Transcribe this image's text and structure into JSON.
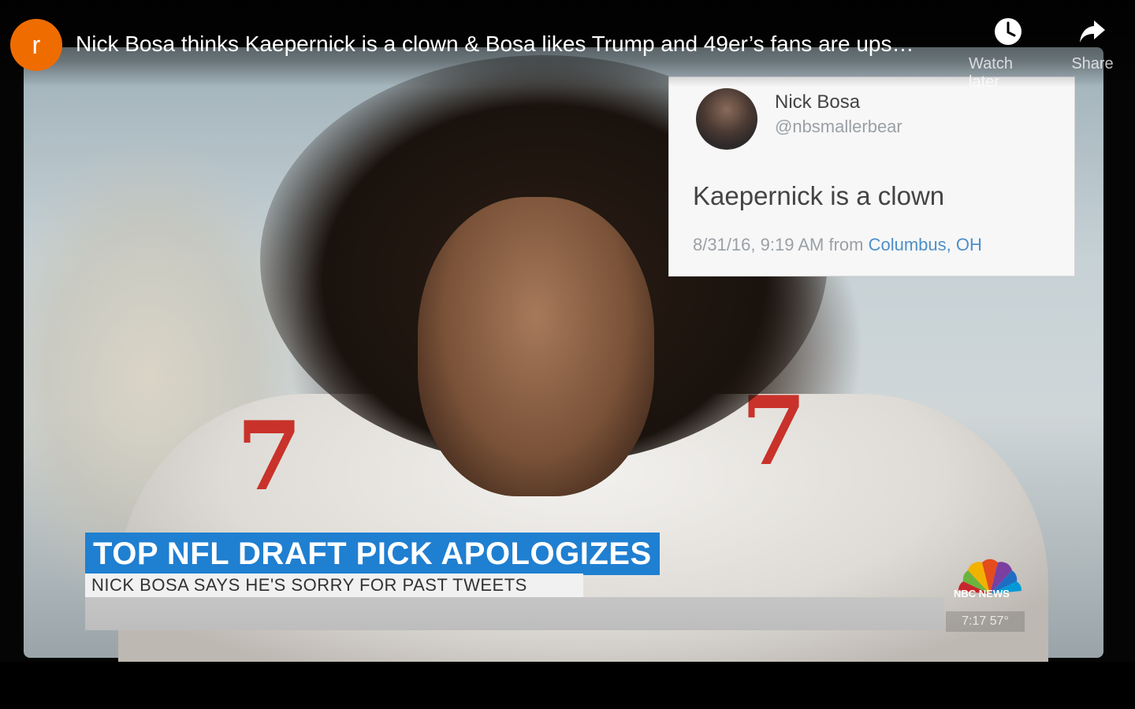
{
  "header": {
    "channel_initial": "r",
    "title": "Nick Bosa thinks Kaepernick is a clown & Bosa likes Trump and 49er’s fans are ups…",
    "actions": [
      {
        "label": "Watch later",
        "icon": "clock-icon"
      },
      {
        "label": "Share",
        "icon": "share-arrow-icon"
      }
    ]
  },
  "tweet": {
    "name": "Nick Bosa",
    "handle": "@nbsmallerbear",
    "text": "Kaepernick is a clown",
    "meta_time": "8/31/16, 9:19 AM from ",
    "meta_location": "Columbus, OH"
  },
  "lower_third": {
    "headline": "TOP NFL DRAFT PICK APOLOGIZES",
    "subhead": "NICK BOSA SAYS HE'S SORRY FOR PAST TWEETS"
  },
  "network": {
    "name": "NBC NEWS",
    "time_temp": "7:17  57°"
  },
  "colors": {
    "avatar_bg": "#ef6c00",
    "headline_bg": "#1f7fd1",
    "tweet_location": "#4d8fc9"
  }
}
